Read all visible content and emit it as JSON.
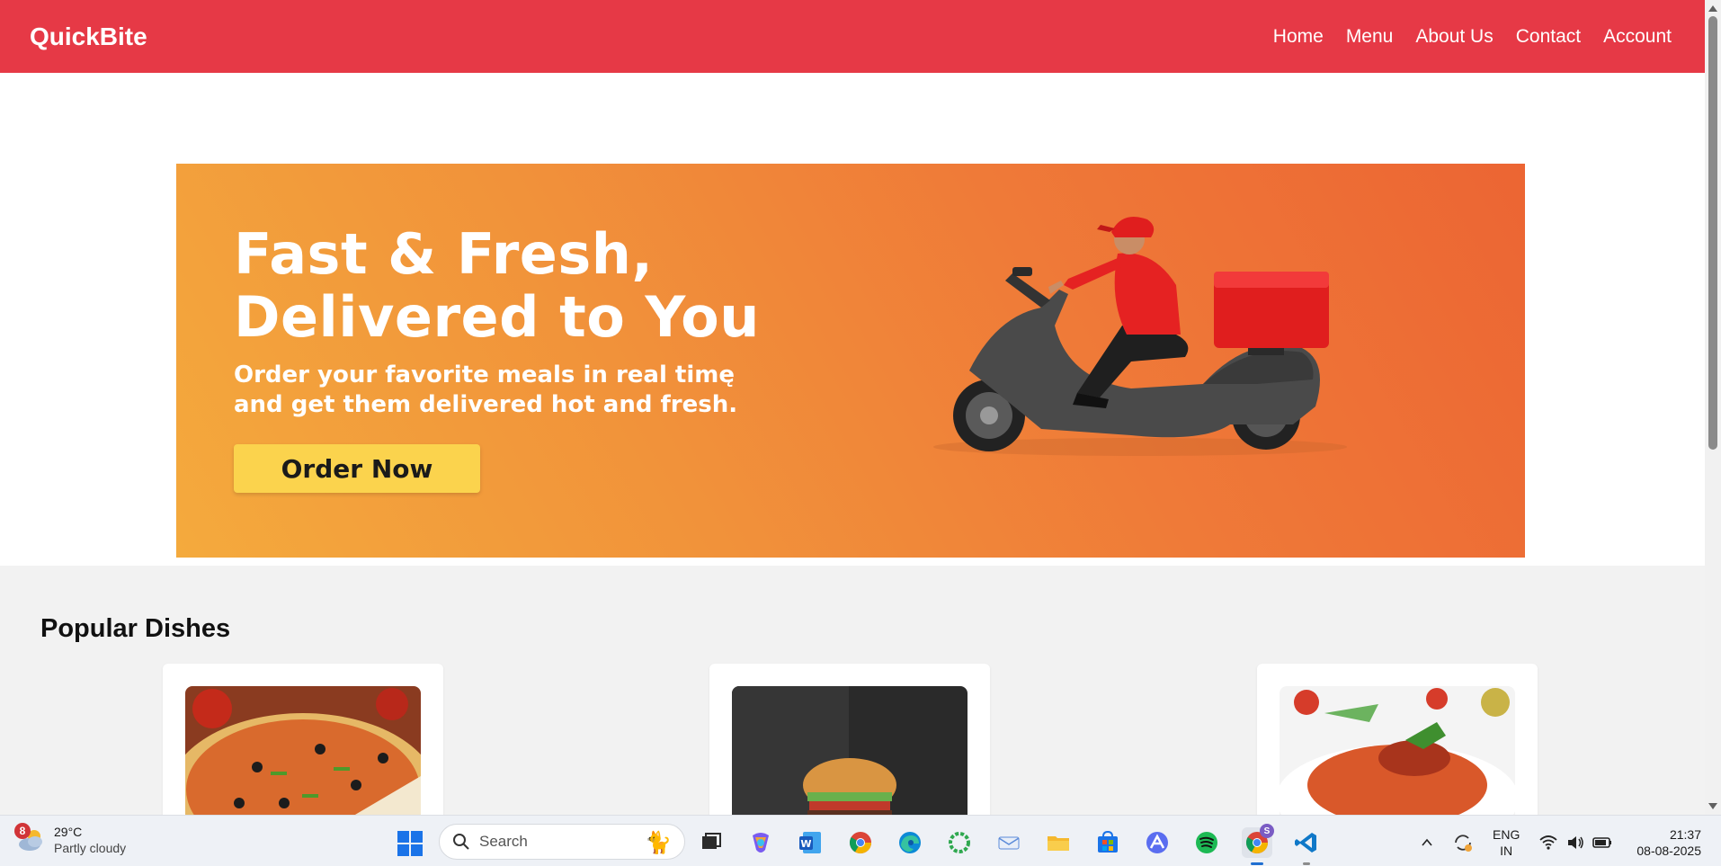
{
  "navbar": {
    "brand": "QuickBite",
    "links": [
      "Home",
      "Menu",
      "About Us",
      "Contact",
      "Account"
    ]
  },
  "hero": {
    "title_line1": "Fast & Fresh,",
    "title_line2": "Delivered to You",
    "subtitle_line1": "Order your favorite meals in real timę",
    "subtitle_line2": "and get them delivered hot and fresh.",
    "cta_label": "Order Now"
  },
  "dishes": {
    "title": "Popular Dishes",
    "items": [
      {
        "image": "pizza"
      },
      {
        "image": "burger"
      },
      {
        "image": "pasta"
      }
    ]
  },
  "taskbar": {
    "weather": {
      "badge": "8",
      "temp": "29°C",
      "desc": "Partly cloudy"
    },
    "search_placeholder": "Search",
    "apps": [
      "task-view",
      "copilot",
      "word",
      "chrome",
      "edge",
      "app-green-ring",
      "zoho-mail",
      "file-explorer",
      "microsoft-store",
      "app-blue-a",
      "spotify",
      "chrome-profile",
      "vscode"
    ],
    "language": {
      "line1": "ENG",
      "line2": "IN"
    },
    "clock": {
      "time": "21:37",
      "date": "08-08-2025"
    },
    "chrome_profile_badge": "S"
  },
  "colors": {
    "navbar": "#e63946",
    "hero_start": "#f4aa3d",
    "hero_end": "#ec6533",
    "cta": "#fbd34d",
    "section_bg": "#f2f2f2"
  }
}
